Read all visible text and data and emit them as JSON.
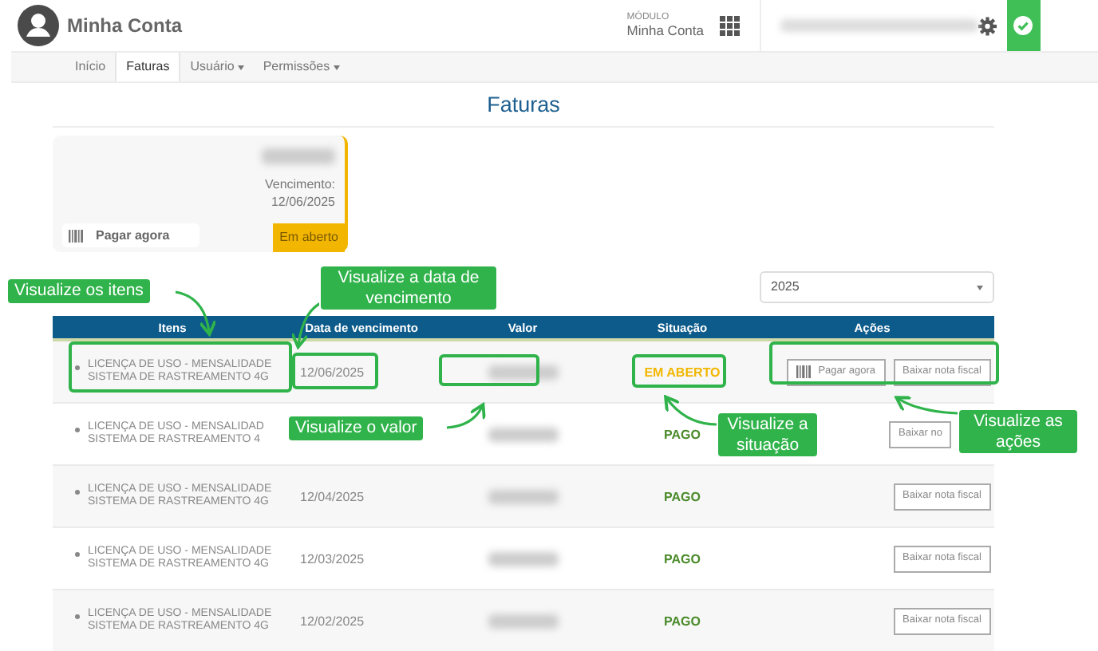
{
  "header": {
    "title": "Minha Conta",
    "module_label": "MÓDULO",
    "module_name": "Minha Conta"
  },
  "nav": [
    {
      "label": "Início",
      "selected": false,
      "dropdown": false
    },
    {
      "label": "Faturas",
      "selected": true,
      "dropdown": false
    },
    {
      "label": "Usuário",
      "selected": false,
      "dropdown": true
    },
    {
      "label": "Permissões",
      "selected": false,
      "dropdown": true
    }
  ],
  "page_title": "Faturas",
  "invoice_card": {
    "due_label": "Vencimento:",
    "due_date": "12/06/2025",
    "pay_button": "Pagar agora",
    "status": "Em aberto"
  },
  "year_select": {
    "value": "2025"
  },
  "table": {
    "columns": [
      "Itens",
      "Data de vencimento",
      "Valor",
      "Situação",
      "Ações"
    ],
    "rows": [
      {
        "item_lines": [
          "LICENÇA DE USO - MENSALIDADE",
          "SISTEMA DE RASTREAMENTO 4G"
        ],
        "due": "12/06/2025",
        "status": "EM ABERTO",
        "pending": true,
        "actions": [
          "Pagar agora",
          "Baixar nota fiscal"
        ]
      },
      {
        "item_lines": [
          "LICENÇA DE USO - MENSALIDAD",
          "SISTEMA DE RASTREAMENTO 4"
        ],
        "status": "PAGO",
        "pending": false,
        "actions": [
          "Baixar no"
        ]
      },
      {
        "item_lines": [
          "LICENÇA DE USO - MENSALIDADE",
          "SISTEMA DE RASTREAMENTO 4G"
        ],
        "due": "12/04/2025",
        "status": "PAGO",
        "pending": false,
        "actions": [
          "Baixar nota fiscal"
        ]
      },
      {
        "item_lines": [
          "LICENÇA DE USO - MENSALIDADE",
          "SISTEMA DE RASTREAMENTO 4G"
        ],
        "due": "12/03/2025",
        "status": "PAGO",
        "pending": false,
        "actions": [
          "Baixar nota fiscal"
        ]
      },
      {
        "item_lines": [
          "LICENÇA DE USO - MENSALIDADE",
          "SISTEMA DE RASTREAMENTO 4G"
        ],
        "due": "12/02/2025",
        "status": "PAGO",
        "pending": false,
        "actions": [
          "Baixar nota fiscal"
        ]
      }
    ]
  },
  "annotations": [
    "Visualize os itens",
    "Visualize a data de vencimento",
    "Visualize o valor",
    "Visualize a situação",
    "Visualize as ações"
  ]
}
